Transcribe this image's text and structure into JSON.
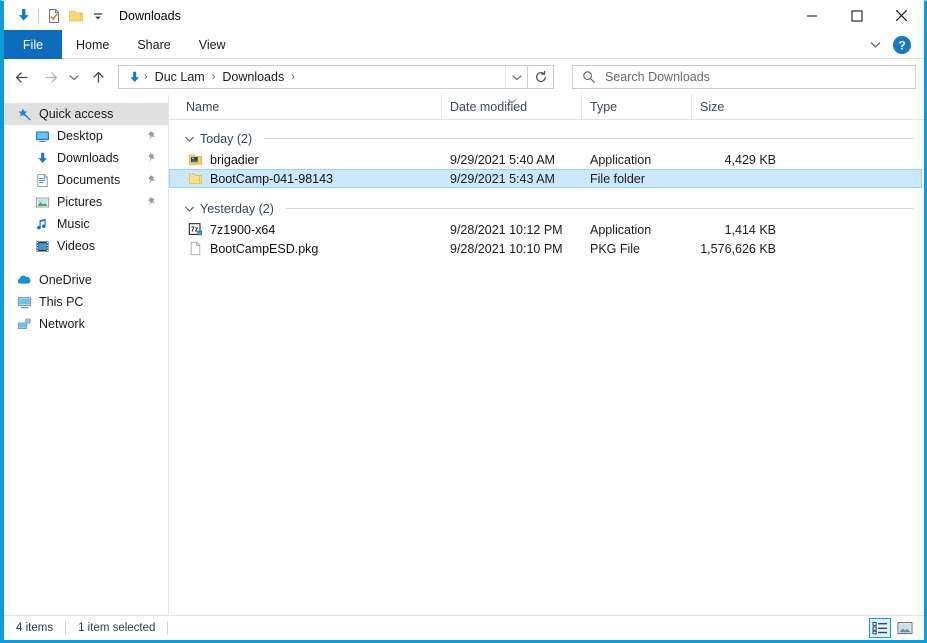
{
  "window": {
    "title": "Downloads",
    "quick_access_toolbar": [
      {
        "name": "downloads-arrow-icon",
        "label": "Downloads"
      },
      {
        "name": "properties-icon",
        "label": "Properties"
      },
      {
        "name": "new-folder-icon",
        "label": "New folder"
      },
      {
        "name": "customize-qat-chevron-icon",
        "label": "Customize Quick Access Toolbar"
      }
    ],
    "controls": {
      "minimize": "Minimize",
      "maximize": "Maximize",
      "close": "Close"
    }
  },
  "ribbon": {
    "tabs": [
      {
        "label": "File",
        "active": true
      },
      {
        "label": "Home",
        "active": false
      },
      {
        "label": "Share",
        "active": false
      },
      {
        "label": "View",
        "active": false
      }
    ],
    "collapse_label": "Minimize the Ribbon",
    "help_label": "Help"
  },
  "navigation": {
    "back_label": "Back",
    "forward_label": "Forward",
    "recent_label": "Recent locations",
    "up_label": "Up",
    "breadcrumbs": [
      "Duc Lam",
      "Downloads"
    ],
    "address_dropdown_label": "Previous locations",
    "refresh_label": "Refresh Downloads"
  },
  "search": {
    "placeholder": "Search Downloads",
    "value": ""
  },
  "sidebar": {
    "items": [
      {
        "label": "Quick access",
        "icon": "star-pin-icon",
        "selected": true,
        "indent": "root",
        "pinned": false
      },
      {
        "label": "Desktop",
        "icon": "desktop-icon",
        "selected": false,
        "indent": "child",
        "pinned": true
      },
      {
        "label": "Downloads",
        "icon": "downloads-arrow-icon",
        "selected": false,
        "indent": "child",
        "pinned": true
      },
      {
        "label": "Documents",
        "icon": "documents-icon",
        "selected": false,
        "indent": "child",
        "pinned": true
      },
      {
        "label": "Pictures",
        "icon": "pictures-icon",
        "selected": false,
        "indent": "child",
        "pinned": true
      },
      {
        "label": "Music",
        "icon": "music-note-icon",
        "selected": false,
        "indent": "child",
        "pinned": false
      },
      {
        "label": "Videos",
        "icon": "videos-icon",
        "selected": false,
        "indent": "child",
        "pinned": false
      },
      {
        "label": "OneDrive",
        "icon": "onedrive-cloud-icon",
        "selected": false,
        "indent": "root",
        "pinned": false
      },
      {
        "label": "This PC",
        "icon": "this-pc-icon",
        "selected": false,
        "indent": "root",
        "pinned": false
      },
      {
        "label": "Network",
        "icon": "network-icon",
        "selected": false,
        "indent": "root",
        "pinned": false
      }
    ]
  },
  "columns": {
    "name": "Name",
    "date_modified": "Date modified",
    "type": "Type",
    "size": "Size",
    "sorted_by": "Date modified",
    "sort_direction": "descending"
  },
  "groups": [
    {
      "label": "Today (2)",
      "expanded": true,
      "rows": [
        {
          "name": "brigadier",
          "date_modified": "9/29/2021 5:40 AM",
          "type": "Application",
          "size": "4,429 KB",
          "icon": "application-folder-icon",
          "selected": false
        },
        {
          "name": "BootCamp-041-98143",
          "date_modified": "9/29/2021 5:43 AM",
          "type": "File folder",
          "size": "",
          "icon": "folder-icon",
          "selected": true
        }
      ]
    },
    {
      "label": "Yesterday (2)",
      "expanded": true,
      "rows": [
        {
          "name": "7z1900-x64",
          "date_modified": "9/28/2021 10:12 PM",
          "type": "Application",
          "size": "1,414 KB",
          "icon": "sevenzip-icon",
          "selected": false
        },
        {
          "name": "BootCampESD.pkg",
          "date_modified": "9/28/2021 10:10 PM",
          "type": "PKG File",
          "size": "1,576,626 KB",
          "icon": "generic-file-icon",
          "selected": false
        }
      ]
    }
  ],
  "statusbar": {
    "item_count": "4 items",
    "selection_count": "1 item selected",
    "details_view_label": "Details view",
    "large_icons_view_label": "Large icons view",
    "active_view": "Details view"
  },
  "colors": {
    "accent": "#0a9cdc",
    "file_tab": "#0f6cbd",
    "selection": "#cce8ff",
    "selection_border": "#99d1ff",
    "sidebar_selected": "#e0e0e0"
  }
}
